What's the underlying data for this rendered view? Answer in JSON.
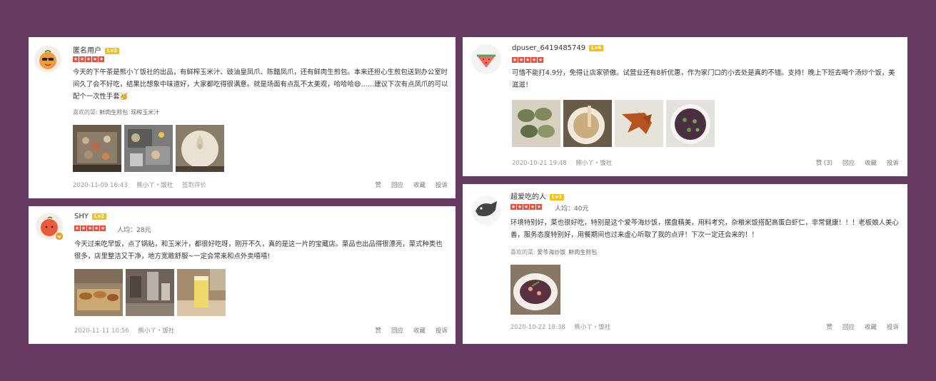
{
  "reviews": [
    {
      "username": "匿名用户",
      "level": "Lv2",
      "stars": 5,
      "text": "今天的下午茶是熊小丫饭社的出品，有鲜榨玉米汁、豉油皇凤爪、陈醋凤爪，还有鲜肉生煎包。本来还担心生煎包送到办公室时间久了会不好吃，结果比想象中味道好，大家都吃得很满意。就是场面有点乱不太美观，哈哈哈😄……建议下次有点凤爪的可以配个一次性手套🥳",
      "fav_label": "喜欢的菜:",
      "fav_dishes": [
        "鲜肉生煎包",
        "现榨玉米汁"
      ],
      "date": "2020-11-09 16:43",
      "shop": "熊小丫・饭社",
      "extra": "签到评价",
      "actions": [
        "赞",
        "回应",
        "收藏",
        "投诉"
      ],
      "photos": [
        "sushi-tray-photo",
        "boxed-pastries-photo",
        "bun-photo"
      ]
    },
    {
      "username": "SHY",
      "level": "Lv2",
      "stars": 5,
      "avg": "人均：28元",
      "text": "今天过来吃早饭，点了锅贴，和玉米汁，都很好吃呀，刚开不久，真的是这一片的宝藏店。菜品也出品得很漂亮，菜式种类也很多，店里整洁又干净，地方宽敞舒服~一定会常来和点外卖嘻嘻!",
      "date": "2020-11-11 10:56",
      "shop": "熊小丫・饭社",
      "actions": [
        "赞",
        "回应",
        "收藏",
        "投诉"
      ],
      "photos": [
        "pastry-display-photo",
        "shop-interior-photo",
        "corn-juice-photo"
      ]
    },
    {
      "username": "dpuser_6419485749",
      "level": "Lv4",
      "stars": 5,
      "text": "可惜不能打4.9分，免得让店家骄傲。试营业还有8折优惠，作为家门口的小去处是真的不错。支持！晚上下班去喝个汤炒个饭，美滋滋！",
      "date": "2020-10-21 19:48",
      "shop": "熊小丫・饭社",
      "actions": [
        "赞 (3)",
        "回应",
        "收藏",
        "投诉"
      ],
      "photos": [
        "dumplings-photo",
        "soup-photo",
        "chicken-feet-photo",
        "greens-photo"
      ]
    },
    {
      "username": "超爱吃的人",
      "level": "Lv3",
      "stars": 5,
      "avg": "人均：40元",
      "text": "环境特别好，菜也很好吃，特别是这个爱芩海炒饭，摆盘精美，用料考究，杂粮米饭搭配高蛋白虾仁，非常健康！！！老板娘人美心善，服务态度特别好，用餐期间也过来虚心听取了我的点评！下次一定还会来的！！",
      "fav_label": "喜欢的菜:",
      "fav_dishes": [
        "爱芩海炒饭",
        "鲜肉生煎包"
      ],
      "date": "2020-10-22 18:38",
      "shop": "熊小丫・饭社",
      "actions": [
        "赞",
        "回应",
        "收藏",
        "投诉"
      ],
      "photos": [
        "fried-rice-plate-photo"
      ]
    }
  ],
  "colors": {
    "background": "#673a63",
    "star": "#f04b3a",
    "level_badge": "#f5c117"
  }
}
